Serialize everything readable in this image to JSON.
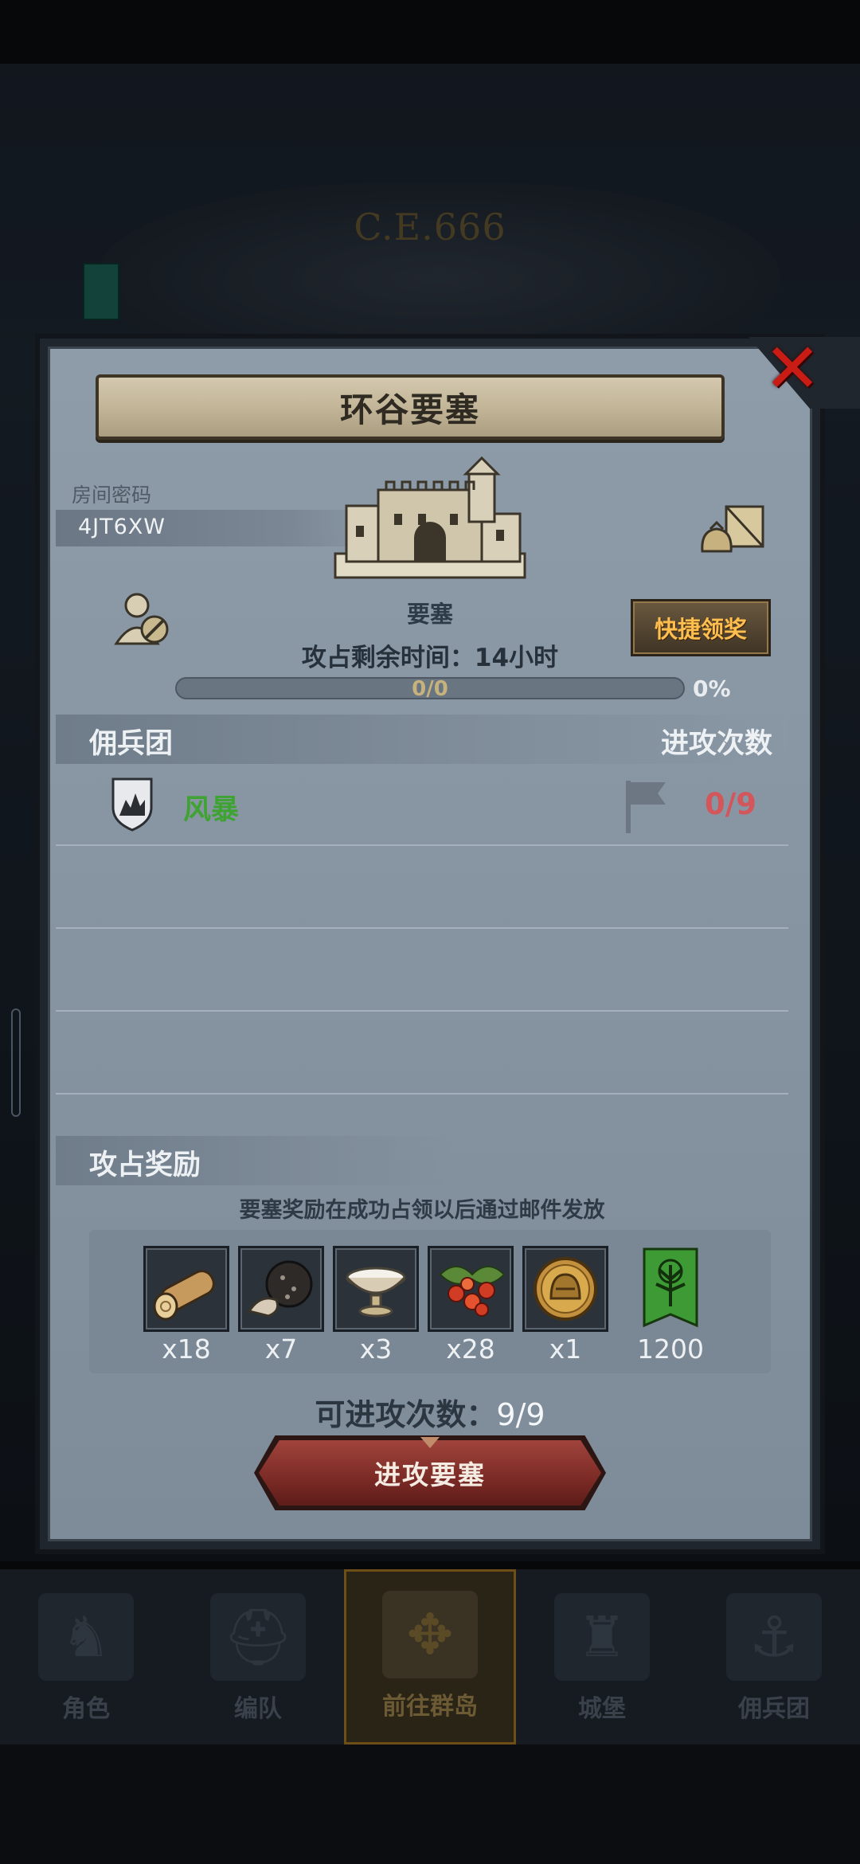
{
  "background": {
    "era_title": "C.E.666"
  },
  "modal": {
    "title": "环谷要塞",
    "room_code_label": "房间密码",
    "room_code": "4JT6XW",
    "fort_label": "要塞",
    "time_remaining": "攻占剩余时间：14小时",
    "progress_text": "0/0",
    "progress_fraction": 0,
    "progress_percent": "0%",
    "quick_claim_label": "快捷领奖",
    "mercenary_header": "佣兵团",
    "attack_count_header": "进攻次数",
    "mercenaries": [
      {
        "name": "风暴",
        "attacks": "0/9",
        "name_color": "#3fa333",
        "count_color": "#d2565a"
      }
    ],
    "rewards_header": "攻占奖励",
    "rewards_note": "要塞奖励在成功占领以后通过邮件发放",
    "rewards": [
      {
        "icon": "wood-log-icon",
        "qty": "x18"
      },
      {
        "icon": "stone-ore-icon",
        "qty": "x7"
      },
      {
        "icon": "silver-bowl-icon",
        "qty": "x3"
      },
      {
        "icon": "berries-icon",
        "qty": "x28"
      },
      {
        "icon": "helmet-coin-icon",
        "qty": "x1"
      },
      {
        "icon": "guild-banner-icon",
        "qty": "1200"
      }
    ],
    "available_attacks_label": "可进攻次数：",
    "available_attacks_value": "9/9",
    "attack_button_label": "进攻要塞"
  },
  "nav": {
    "items": [
      {
        "label": "角色",
        "icon": "knight-icon"
      },
      {
        "label": "编队",
        "icon": "helmet-icon"
      },
      {
        "label": "前往群岛",
        "icon": "compass-icon",
        "active": true
      },
      {
        "label": "城堡",
        "icon": "castle-icon"
      },
      {
        "label": "佣兵团",
        "icon": "ship-icon"
      }
    ]
  },
  "colors": {
    "modal_bg": "#8e9caa",
    "accent_gold": "#ffbf4f",
    "close_red": "#c81c14",
    "attack_button": "#8b302a",
    "mercenary_green": "#3fa333",
    "count_red": "#d2565a"
  }
}
